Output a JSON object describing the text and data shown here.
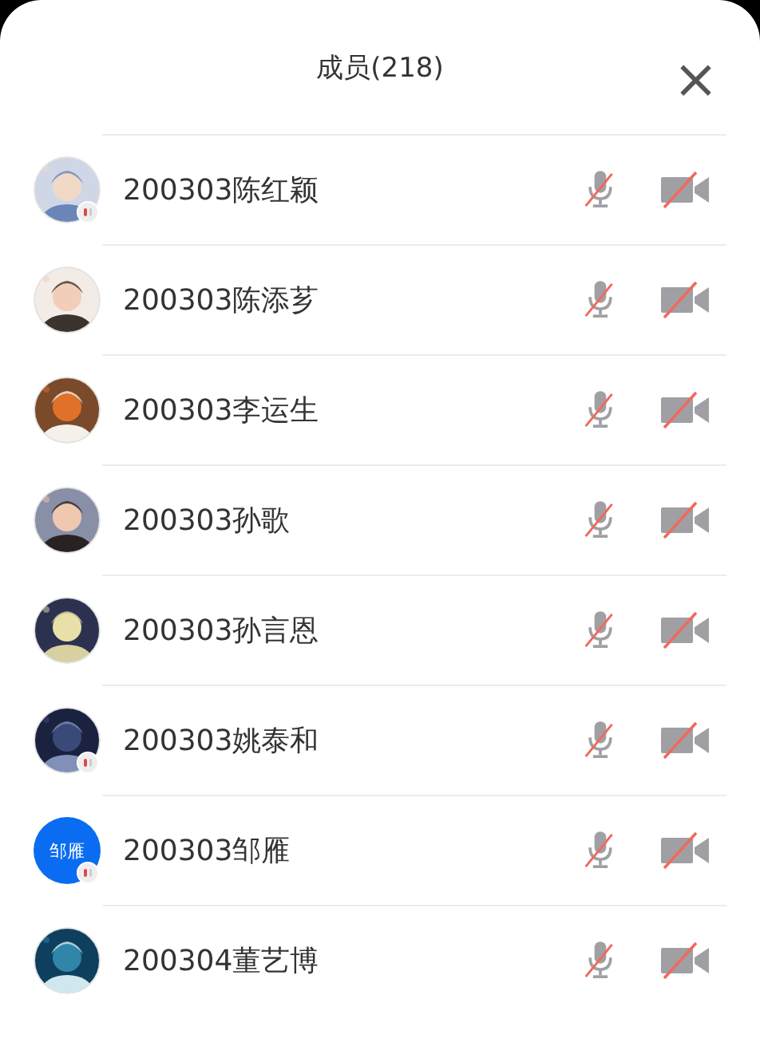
{
  "header": {
    "title": "成员(218)",
    "close": "×"
  },
  "members": [
    {
      "name": "200303陈红颖",
      "speaker_badge": true,
      "mic_muted": true,
      "camera_off": true
    },
    {
      "name": "200303陈添芗",
      "speaker_badge": false,
      "mic_muted": true,
      "camera_off": true
    },
    {
      "name": "200303李运生",
      "speaker_badge": false,
      "mic_muted": true,
      "camera_off": true
    },
    {
      "name": "200303孙歌",
      "speaker_badge": false,
      "mic_muted": true,
      "camera_off": true
    },
    {
      "name": "200303孙言恩",
      "speaker_badge": false,
      "mic_muted": true,
      "camera_off": true
    },
    {
      "name": "200303姚泰和",
      "speaker_badge": true,
      "mic_muted": true,
      "camera_off": true
    },
    {
      "name": "200303邹雁",
      "avatar": {
        "kind": "text",
        "text": "邹雁",
        "color": "#0a6cf0"
      },
      "speaker_badge": true,
      "mic_muted": true,
      "camera_off": true
    },
    {
      "name": "200304董艺博",
      "speaker_badge": false,
      "mic_muted": true,
      "camera_off": true
    }
  ]
}
